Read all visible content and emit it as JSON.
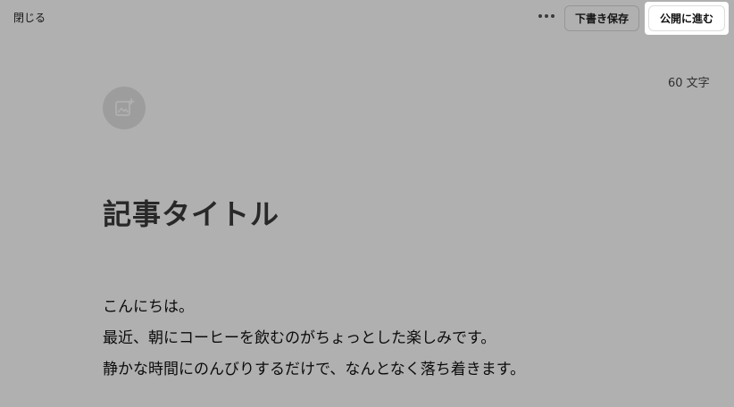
{
  "header": {
    "close_label": "閉じる",
    "more_icon": "more-horizontal-icon",
    "draft_label": "下書き保存",
    "publish_label": "公開に進む"
  },
  "editor": {
    "char_count": "60 文字",
    "image_icon": "add-image-icon",
    "title": "記事タイトル",
    "paragraphs": [
      "こんにちは。",
      "最近、朝にコーヒーを飲むのがちょっとした楽しみです。",
      "静かな時間にのんびりするだけで、なんとなく落ち着きます。"
    ]
  },
  "colors": {
    "overlay": "#000000",
    "text": "#111111",
    "icon_bg": "#e4e4e4"
  }
}
